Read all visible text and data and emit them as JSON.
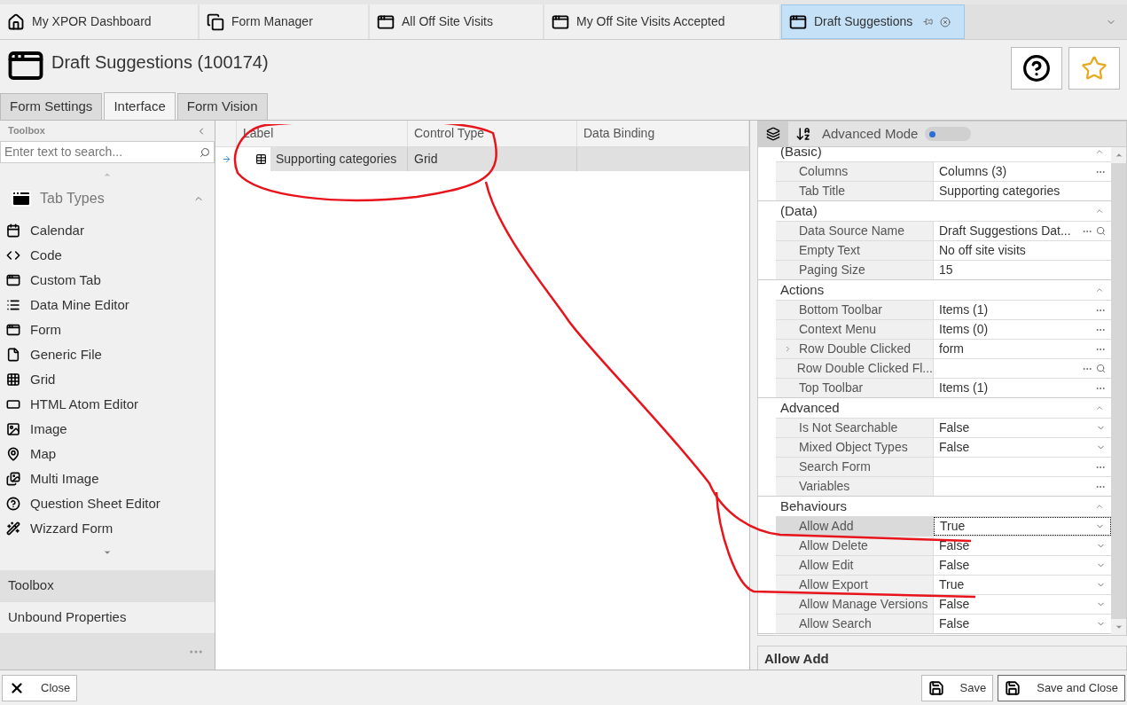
{
  "doc_tabs": [
    {
      "label": "My XPOR Dashboard",
      "selected": false
    },
    {
      "label": "Form Manager",
      "selected": false
    },
    {
      "label": "All Off Site Visits",
      "selected": false
    },
    {
      "label": "My Off Site Visits Accepted",
      "selected": false
    },
    {
      "label": "Draft Suggestions",
      "selected": true
    }
  ],
  "header": {
    "title": "Draft Suggestions (100174)"
  },
  "sub_tabs": [
    {
      "label": "Form Settings",
      "selected": false
    },
    {
      "label": "Interface",
      "selected": true
    },
    {
      "label": "Form Vision",
      "selected": false
    }
  ],
  "toolbox": {
    "title": "Toolbox",
    "search": {
      "placeholder": "Enter text to search..."
    },
    "group": "Tab Types",
    "items": [
      "Calendar",
      "Code",
      "Custom Tab",
      "Data Mine Editor",
      "Form",
      "Generic File",
      "Grid",
      "HTML Atom Editor",
      "Image",
      "Map",
      "Multi Image",
      "Question Sheet Editor",
      "Wizzard Form"
    ],
    "sections": [
      {
        "label": "Toolbox",
        "selected": true
      },
      {
        "label": "Unbound Properties",
        "selected": false
      }
    ]
  },
  "designer": {
    "columns": [
      "Label",
      "Control Type",
      "Data Binding"
    ],
    "rows": [
      {
        "label": "Supporting categories",
        "control_type": "Grid",
        "selected": true
      }
    ]
  },
  "properties": {
    "advanced_mode": {
      "label": "Advanced Mode",
      "on": false
    },
    "categories": [
      {
        "name": "(Basic)",
        "rows": [
          {
            "name": "Columns",
            "value": "Columns (3)",
            "kind": "ellipsis",
            "expandable": false,
            "selected": false
          },
          {
            "name": "Tab Title",
            "value": "Supporting categories",
            "kind": "text",
            "expandable": false,
            "selected": false
          }
        ]
      },
      {
        "name": "(Data)",
        "rows": [
          {
            "name": "Data Source Name",
            "value": "Draft Suggestions Dat...",
            "kind": "lookup",
            "expandable": false,
            "selected": false
          },
          {
            "name": "Empty Text",
            "value": "No off site visits",
            "kind": "text",
            "expandable": false,
            "selected": false
          },
          {
            "name": "Paging Size",
            "value": "15",
            "kind": "text",
            "expandable": false,
            "selected": false
          }
        ]
      },
      {
        "name": "Actions",
        "rows": [
          {
            "name": "Bottom Toolbar",
            "value": "Items (1)",
            "kind": "ellipsis",
            "expandable": false,
            "selected": false
          },
          {
            "name": "Context Menu",
            "value": "Items (0)",
            "kind": "ellipsis",
            "expandable": false,
            "selected": false
          },
          {
            "name": "Row Double Clicked",
            "value": "form",
            "kind": "ellipsis",
            "expandable": true,
            "selected": false
          },
          {
            "name": "Row Double Clicked Fl...",
            "kind": "lookup",
            "expandable": false,
            "selected": false
          },
          {
            "name": "Top Toolbar",
            "value": "Items (1)",
            "kind": "ellipsis",
            "expandable": false,
            "selected": false
          }
        ]
      },
      {
        "name": "Advanced",
        "rows": [
          {
            "name": "Is Not Searchable",
            "value": "False",
            "kind": "dropdown",
            "expandable": false,
            "selected": false
          },
          {
            "name": "Mixed Object Types",
            "value": "False",
            "kind": "dropdown",
            "expandable": false,
            "selected": false
          },
          {
            "name": "Search Form",
            "kind": "ellipsis",
            "expandable": false,
            "selected": false
          },
          {
            "name": "Variables",
            "kind": "ellipsis",
            "expandable": false,
            "selected": false
          }
        ]
      },
      {
        "name": "Behaviours",
        "rows": [
          {
            "name": "Allow Add",
            "value": "True",
            "kind": "dropdown",
            "expandable": false,
            "selected": true
          },
          {
            "name": "Allow Delete",
            "value": "False",
            "kind": "dropdown",
            "expandable": false,
            "selected": false
          },
          {
            "name": "Allow Edit",
            "value": "False",
            "kind": "dropdown",
            "expandable": false,
            "selected": false
          },
          {
            "name": "Allow Export",
            "value": "True",
            "kind": "dropdown",
            "expandable": false,
            "selected": false
          },
          {
            "name": "Allow Manage Versions",
            "value": "False",
            "kind": "dropdown",
            "expandable": false,
            "selected": false
          },
          {
            "name": "Allow Search",
            "value": "False",
            "kind": "dropdown",
            "expandable": false,
            "selected": false
          }
        ]
      }
    ],
    "description": "Allow Add"
  },
  "footer": {
    "buttons": [
      {
        "label": "Close",
        "kind": "close"
      },
      {
        "label": "Save",
        "kind": "save"
      },
      {
        "label": "Save and Close",
        "kind": "save-close"
      }
    ]
  }
}
